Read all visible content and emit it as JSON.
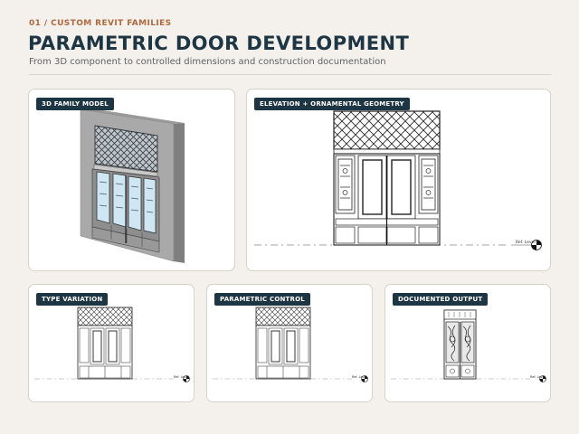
{
  "header": {
    "eyebrow": "01 / CUSTOM REVIT FAMILIES",
    "title": "PARAMETRIC DOOR DEVELOPMENT",
    "subtitle": "From 3D component to controlled dimensions and construction documentation"
  },
  "panels": {
    "model": {
      "label": "3D FAMILY MODEL"
    },
    "elevation": {
      "label": "ELEVATION + ORNAMENTAL GEOMETRY",
      "level_label": "Ref. Level"
    },
    "type_variation": {
      "label": "TYPE VARIATION",
      "level_label": "Ref. Level"
    },
    "parametric_control": {
      "label": "PARAMETRIC CONTROL",
      "level_label": "Ref. Level"
    },
    "documented_output": {
      "label": "DOCUMENTED OUTPUT",
      "level_label": "Ref. Level"
    }
  },
  "colors": {
    "navy": "#1e3544",
    "accent": "#b0683c",
    "background": "#f4f1ec"
  }
}
